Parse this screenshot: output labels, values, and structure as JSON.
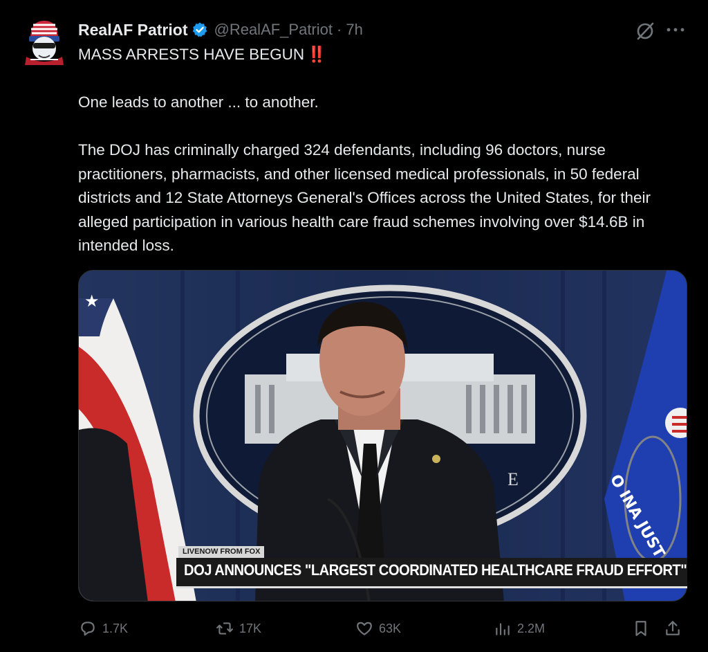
{
  "tweet": {
    "display_name": "RealAF Patriot",
    "handle": "@RealAF_Patriot",
    "separator": "·",
    "time": "7h",
    "text": {
      "line1": "MASS ARRESTS HAVE BEGUN",
      "line1_emoji": "‼️",
      "line2": "One leads to another ... to another.",
      "line3": "The DOJ has criminally charged 324 defendants, including 96 doctors, nurse practitioners, pharmacists, and other licensed medical professionals, in 50 federal districts and 12 State Attorneys General's Offices across the United States, for their alleged participation in various health care fraud schemes involving over $14.6B in intended loss."
    }
  },
  "media": {
    "ticker_small": "LIVENOW FROM FOX",
    "ticker_headline": "DOJ ANNOUNCES \"LARGEST COORDINATED HEALTHCARE FRAUD EFFORT\"",
    "seal_letter": "E",
    "flag_letters": "O  INA  JUST"
  },
  "actions": {
    "replies": "1.7K",
    "reposts": "17K",
    "likes": "63K",
    "views": "2.2M"
  },
  "colors": {
    "background": "#000000",
    "text": "#e7e9ea",
    "muted": "#71767b",
    "verified": "#1d9bf0",
    "emoji_red": "#e0245e"
  },
  "icons": [
    "avatar",
    "verified-badge-icon",
    "grok-icon",
    "more-icon",
    "reply-icon",
    "repost-icon",
    "like-icon",
    "views-icon",
    "bookmark-icon",
    "share-icon"
  ]
}
